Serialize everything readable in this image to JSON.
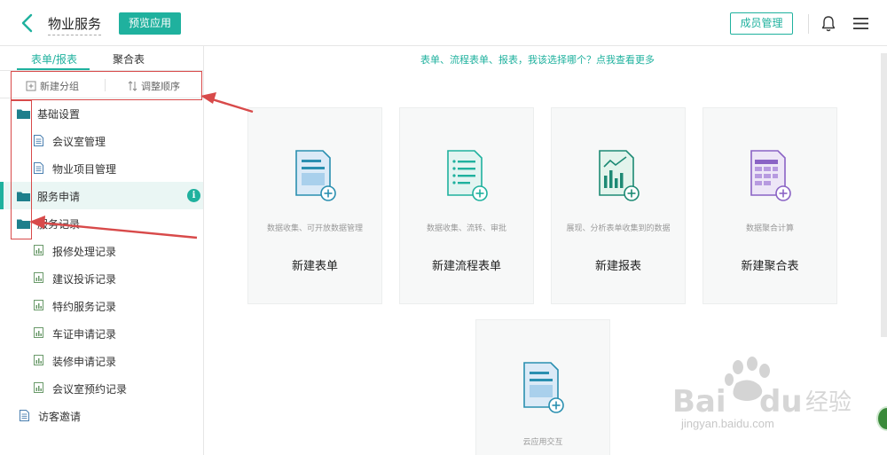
{
  "header": {
    "title": "物业服务",
    "preview_label": "预览应用",
    "member_label": "成员管理"
  },
  "sidebar": {
    "tabs": [
      {
        "label": "表单/报表"
      },
      {
        "label": "聚合表"
      }
    ],
    "toolbar": {
      "new_group": "新建分组",
      "reorder": "调整顺序"
    },
    "tree": [
      {
        "label": "基础设置",
        "type": "folder"
      },
      {
        "label": "会议室管理",
        "type": "form"
      },
      {
        "label": "物业项目管理",
        "type": "form"
      },
      {
        "label": "服务申请",
        "type": "folder",
        "badge": "i"
      },
      {
        "label": "服务记录",
        "type": "folder"
      },
      {
        "label": "报修处理记录",
        "type": "report"
      },
      {
        "label": "建议投诉记录",
        "type": "report"
      },
      {
        "label": "特约服务记录",
        "type": "report"
      },
      {
        "label": "车证申请记录",
        "type": "report"
      },
      {
        "label": "装修申请记录",
        "type": "report"
      },
      {
        "label": "会议室预约记录",
        "type": "report"
      },
      {
        "label": "访客邀请",
        "type": "form"
      }
    ]
  },
  "main": {
    "help_text": "表单、流程表单、报表，我该选择哪个？点我查看更多",
    "cards": [
      {
        "desc": "数据收集、可开放数据管理",
        "name": "新建表单",
        "icon": "form-icon"
      },
      {
        "desc": "数据收集、流转、审批",
        "name": "新建流程表单",
        "icon": "flow-form-icon"
      },
      {
        "desc": "展现、分析表单收集到的数据",
        "name": "新建报表",
        "icon": "report-icon"
      },
      {
        "desc": "数据聚合计算",
        "name": "新建聚合表",
        "icon": "aggregate-icon"
      },
      {
        "desc": "云应用交互",
        "name": "",
        "icon": "cloud-interact-icon"
      }
    ]
  },
  "colors": {
    "accent": "#1fb19e",
    "annotation": "#d84a4a",
    "aggregate": "#8a63c5"
  },
  "watermark": {
    "text": "jingyan.baidu.com"
  }
}
